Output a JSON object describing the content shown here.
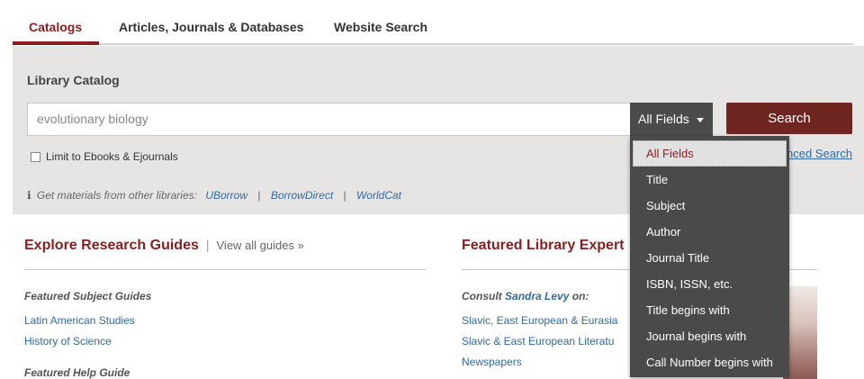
{
  "tabs": [
    {
      "label": "Catalogs"
    },
    {
      "label": "Articles, Journals & Databases"
    },
    {
      "label": "Website Search"
    }
  ],
  "catalog": {
    "title": "Library Catalog",
    "search_value": "evolutionary biology",
    "field_selected": "All Fields",
    "search_button": "Search",
    "limit_label": "Limit to Ebooks & Ejournals",
    "advanced_link": "nced Search",
    "other_libs_prefix": "Get materials from other libraries:",
    "other_libs_links": [
      "UBorrow",
      "BorrowDirect",
      "WorldCat"
    ],
    "separator": "|"
  },
  "field_options": [
    "All Fields",
    "Title",
    "Subject",
    "Author",
    "Journal Title",
    "ISBN, ISSN, etc.",
    "Title begins with",
    "Journal begins with",
    "Call Number begins with"
  ],
  "guides": {
    "heading": "Explore Research Guides",
    "separator": "|",
    "view_all": "View all guides »",
    "subject_label": "Featured Subject Guides",
    "subject_links": [
      "Latin American Studies",
      "History of Science"
    ],
    "help_label": "Featured Help Guide"
  },
  "expert": {
    "heading": "Featured Library Expert",
    "consult_prefix": "Consult",
    "consult_name": "Sandra Levy",
    "consult_suffix": "on:",
    "links": [
      "Slavic, East European & Eurasia",
      "Slavic & East European Literatu",
      "Newspapers"
    ]
  },
  "colors": {
    "accent": "#8a1e1e",
    "button": "#6f2520",
    "link": "#2f6aa7",
    "panel": "#e6e5e3"
  }
}
